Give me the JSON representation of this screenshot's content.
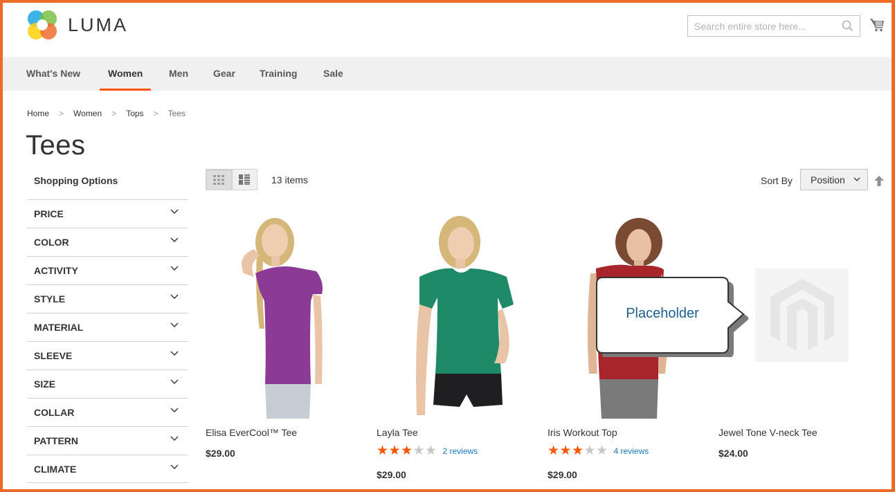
{
  "store": {
    "logo_text": "LUMA",
    "search_placeholder": "Search entire store here...",
    "search_value": ""
  },
  "nav": {
    "items": [
      {
        "label": "What's New",
        "active": false
      },
      {
        "label": "Women",
        "active": true
      },
      {
        "label": "Men",
        "active": false
      },
      {
        "label": "Gear",
        "active": false
      },
      {
        "label": "Training",
        "active": false
      },
      {
        "label": "Sale",
        "active": false
      }
    ]
  },
  "breadcrumb": {
    "items": [
      "Home",
      "Women",
      "Tops"
    ],
    "current": "Tees",
    "separator": ">"
  },
  "page": {
    "title": "Tees"
  },
  "sidebar": {
    "title": "Shopping Options",
    "filters": [
      "PRICE",
      "COLOR",
      "ACTIVITY",
      "STYLE",
      "MATERIAL",
      "SLEEVE",
      "SIZE",
      "COLLAR",
      "PATTERN",
      "CLIMATE"
    ]
  },
  "toolbar": {
    "view_modes": [
      "grid",
      "list"
    ],
    "active_mode": "grid",
    "count": "13 items",
    "sort_label": "Sort By",
    "sort_value": "Position",
    "sort_direction": "ascending"
  },
  "products": [
    {
      "name": "Elisa EverCool™ Tee",
      "price": "$29.00",
      "rating": null,
      "reviews": null,
      "shirt_color": "#8b3a96",
      "bottom_color": "#c8ccd4"
    },
    {
      "name": "Layla Tee",
      "price": "$29.00",
      "rating": 3,
      "reviews": "2 reviews",
      "shirt_color": "#1f8a68",
      "bottom_color": "#1f1f22"
    },
    {
      "name": "Iris Workout Top",
      "price": "$29.00",
      "rating": 3,
      "reviews": "4 reviews",
      "shirt_color": "#a8262b",
      "bottom_color": "#7a7a7a"
    },
    {
      "name": "Jewel Tone V-neck Tee",
      "price": "$24.00",
      "rating": null,
      "reviews": null,
      "image": "placeholder"
    }
  ],
  "callout": {
    "text": "Placeholder"
  },
  "colors": {
    "accent": "#ff5501",
    "frame": "#eb6b26",
    "link": "#1979c3",
    "nav_bg": "#f0f0f0"
  }
}
